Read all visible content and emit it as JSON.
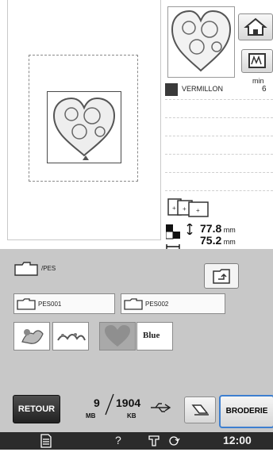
{
  "preview": {
    "thread_color_name": "VERMILLON",
    "thread_col_header": "min",
    "thread_time": "6",
    "size_height": "77.8",
    "size_width": "75.2",
    "size_unit": "mm"
  },
  "browser": {
    "path": "/PES",
    "folders": [
      "PES001",
      "PES002"
    ],
    "thumbnails": [
      {
        "name": "design-1"
      },
      {
        "name": "design-2"
      },
      {
        "name": "design-3"
      },
      {
        "name": "Blue",
        "label": "Blue"
      }
    ]
  },
  "bottom": {
    "back_label": "RETOUR",
    "mem_used": "9",
    "mem_used_unit": "MB",
    "mem_free": "1904",
    "mem_free_unit": "KB",
    "embroidery_label": "BRODERIE"
  },
  "status": {
    "help": "?",
    "clock": "12:00"
  },
  "colors": {
    "highlight": "#3d7fd0",
    "panel_gray": "#c8c8c8",
    "status_bg": "#2b2b2b"
  }
}
